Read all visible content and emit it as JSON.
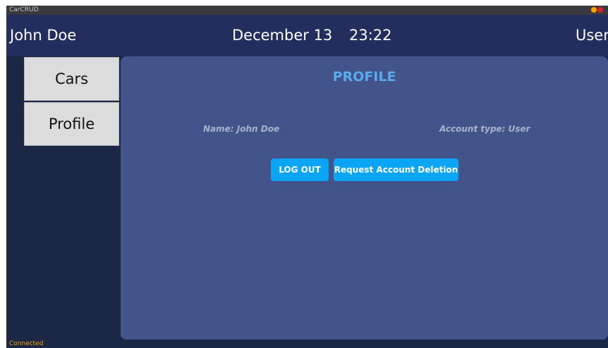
{
  "window": {
    "title": "CarCRUD"
  },
  "header": {
    "user_name": "John Doe",
    "date": "December 13",
    "time": "23:22",
    "role": "User"
  },
  "sidebar": {
    "items": [
      {
        "label": "Cars"
      },
      {
        "label": "Profile"
      }
    ]
  },
  "profile": {
    "title": "PROFILE",
    "name_text": "Name: John Doe",
    "account_type_text": "Account type: User",
    "logout_label": "LOG OUT",
    "delete_label": "Request Account Deletion"
  },
  "status": {
    "text": "Connected"
  },
  "colors": {
    "background": "#1b2744",
    "header": "#232e5f",
    "content_panel": "#43548a",
    "title_accent": "#5aa9ef",
    "button": "#0aa6f5",
    "status_text": "#f5a300",
    "window_min": "#f5a300",
    "window_close": "#e02020"
  }
}
